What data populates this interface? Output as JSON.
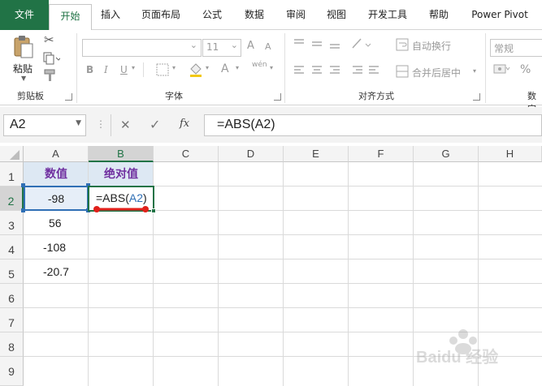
{
  "ribbon_tabs": [
    "文件",
    "开始",
    "插入",
    "页面布局",
    "公式",
    "数据",
    "审阅",
    "视图",
    "开发工具",
    "帮助",
    "Power Pivot"
  ],
  "clipboard": {
    "paste_label": "粘贴",
    "group_label": "剪贴板"
  },
  "font": {
    "group_label": "字体",
    "size_value": "11",
    "bold": "B",
    "italic": "I",
    "underline": "U",
    "font_color": "A",
    "grow": "A",
    "shrink": "A",
    "wen": "wén"
  },
  "alignment": {
    "group_label": "对齐方式",
    "wrap_label": "自动换行",
    "merge_label": "合并后居中"
  },
  "number": {
    "format_value": "常规",
    "percent": "%",
    "group_label_partial": "数字"
  },
  "formula_bar": {
    "name_box": "A2",
    "formula": "=ABS(A2)",
    "cancel": "✕",
    "enter": "✓",
    "fx": "fx"
  },
  "columns": [
    "A",
    "B",
    "C",
    "D",
    "E",
    "F",
    "G",
    "H"
  ],
  "rows": [
    "1",
    "2",
    "3",
    "4",
    "5",
    "6",
    "7",
    "8",
    "9"
  ],
  "cells": {
    "A1": "数值",
    "B1": "绝对值",
    "A2": "-98",
    "B2_prefix": "=ABS(",
    "B2_ref": "A2",
    "B2_suffix": ")",
    "A3": "56",
    "A4": "-108",
    "A5": "-20.7"
  },
  "colors": {
    "excel_green": "#217346",
    "header_fill": "#dde8f3",
    "header_text": "#7030a0",
    "ref_blue": "#2f6fb5",
    "annotation_red": "#e0201a"
  },
  "watermark": "Baidu 经验"
}
